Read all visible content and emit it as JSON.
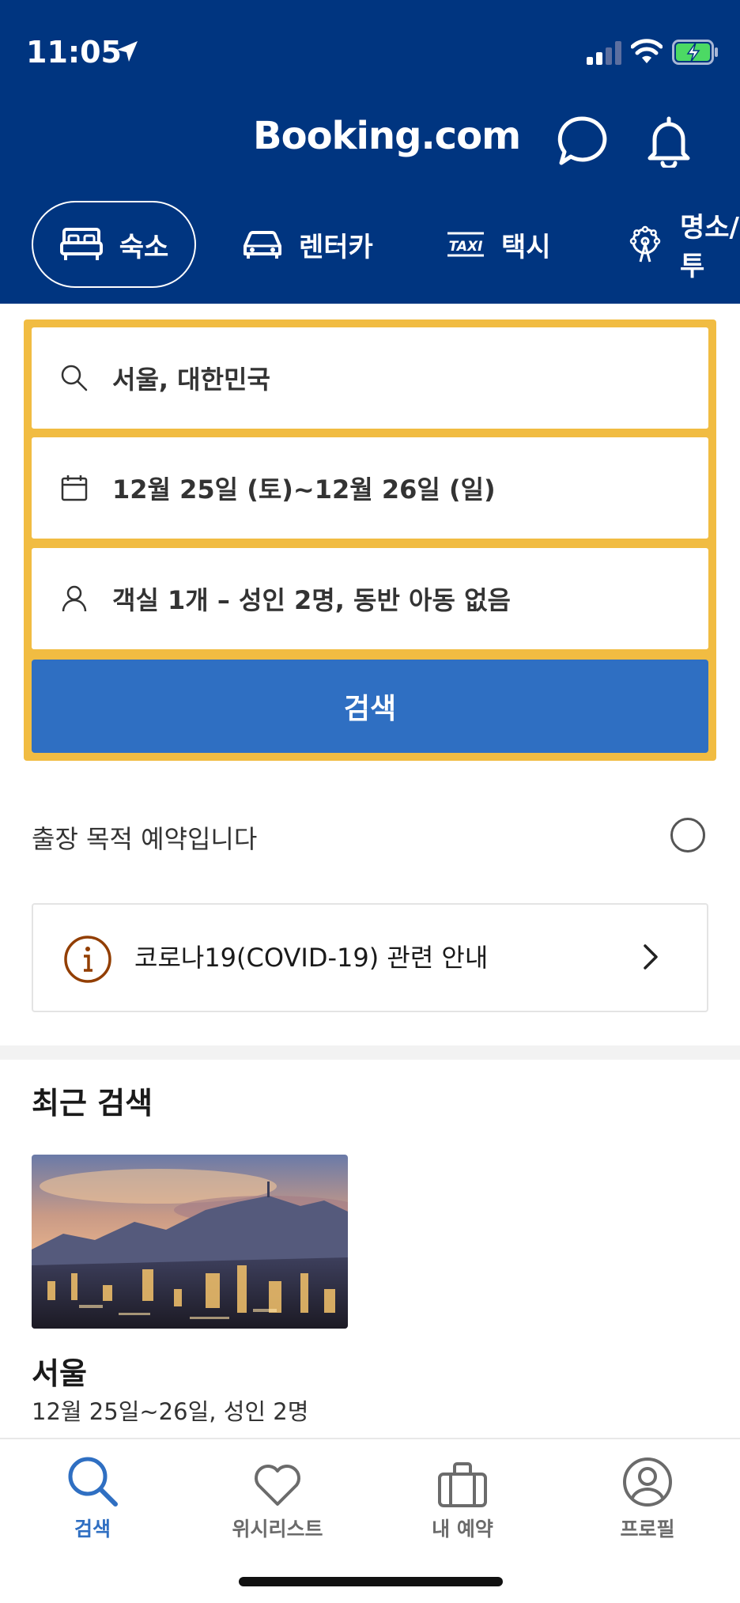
{
  "status_bar": {
    "time": "11:05"
  },
  "header": {
    "brand": "Booking.com"
  },
  "tabs": [
    {
      "label": "숙소",
      "icon": "bed-icon"
    },
    {
      "label": "렌터카",
      "icon": "car-icon"
    },
    {
      "label": "택시",
      "icon": "taxi-icon"
    },
    {
      "label": "명소/투",
      "icon": "attraction-icon"
    }
  ],
  "search": {
    "destination": "서울, 대한민국",
    "dates": "12월 25일 (토)~12월 26일 (일)",
    "guests": "객실 1개 – 성인 2명, 동반 아동 없음",
    "button": "검색"
  },
  "business_trip": {
    "label": "출장 목적 예약입니다"
  },
  "covid_notice": {
    "label": "코로나19(COVID-19) 관련 안내"
  },
  "recent": {
    "title": "최근 검색",
    "items": [
      {
        "city": "서울",
        "detail": "12월 25일~26일, 성인 2명"
      }
    ]
  },
  "bottom_nav": [
    {
      "label": "검색",
      "icon": "search-icon",
      "active": true
    },
    {
      "label": "위시리스트",
      "icon": "heart-icon",
      "active": false
    },
    {
      "label": "내 예약",
      "icon": "briefcase-icon",
      "active": false
    },
    {
      "label": "프로필",
      "icon": "profile-icon",
      "active": false
    }
  ],
  "colors": {
    "brand_blue": "#003580",
    "button_blue": "#2f6fc2",
    "highlight_yellow": "#f1bc42"
  }
}
